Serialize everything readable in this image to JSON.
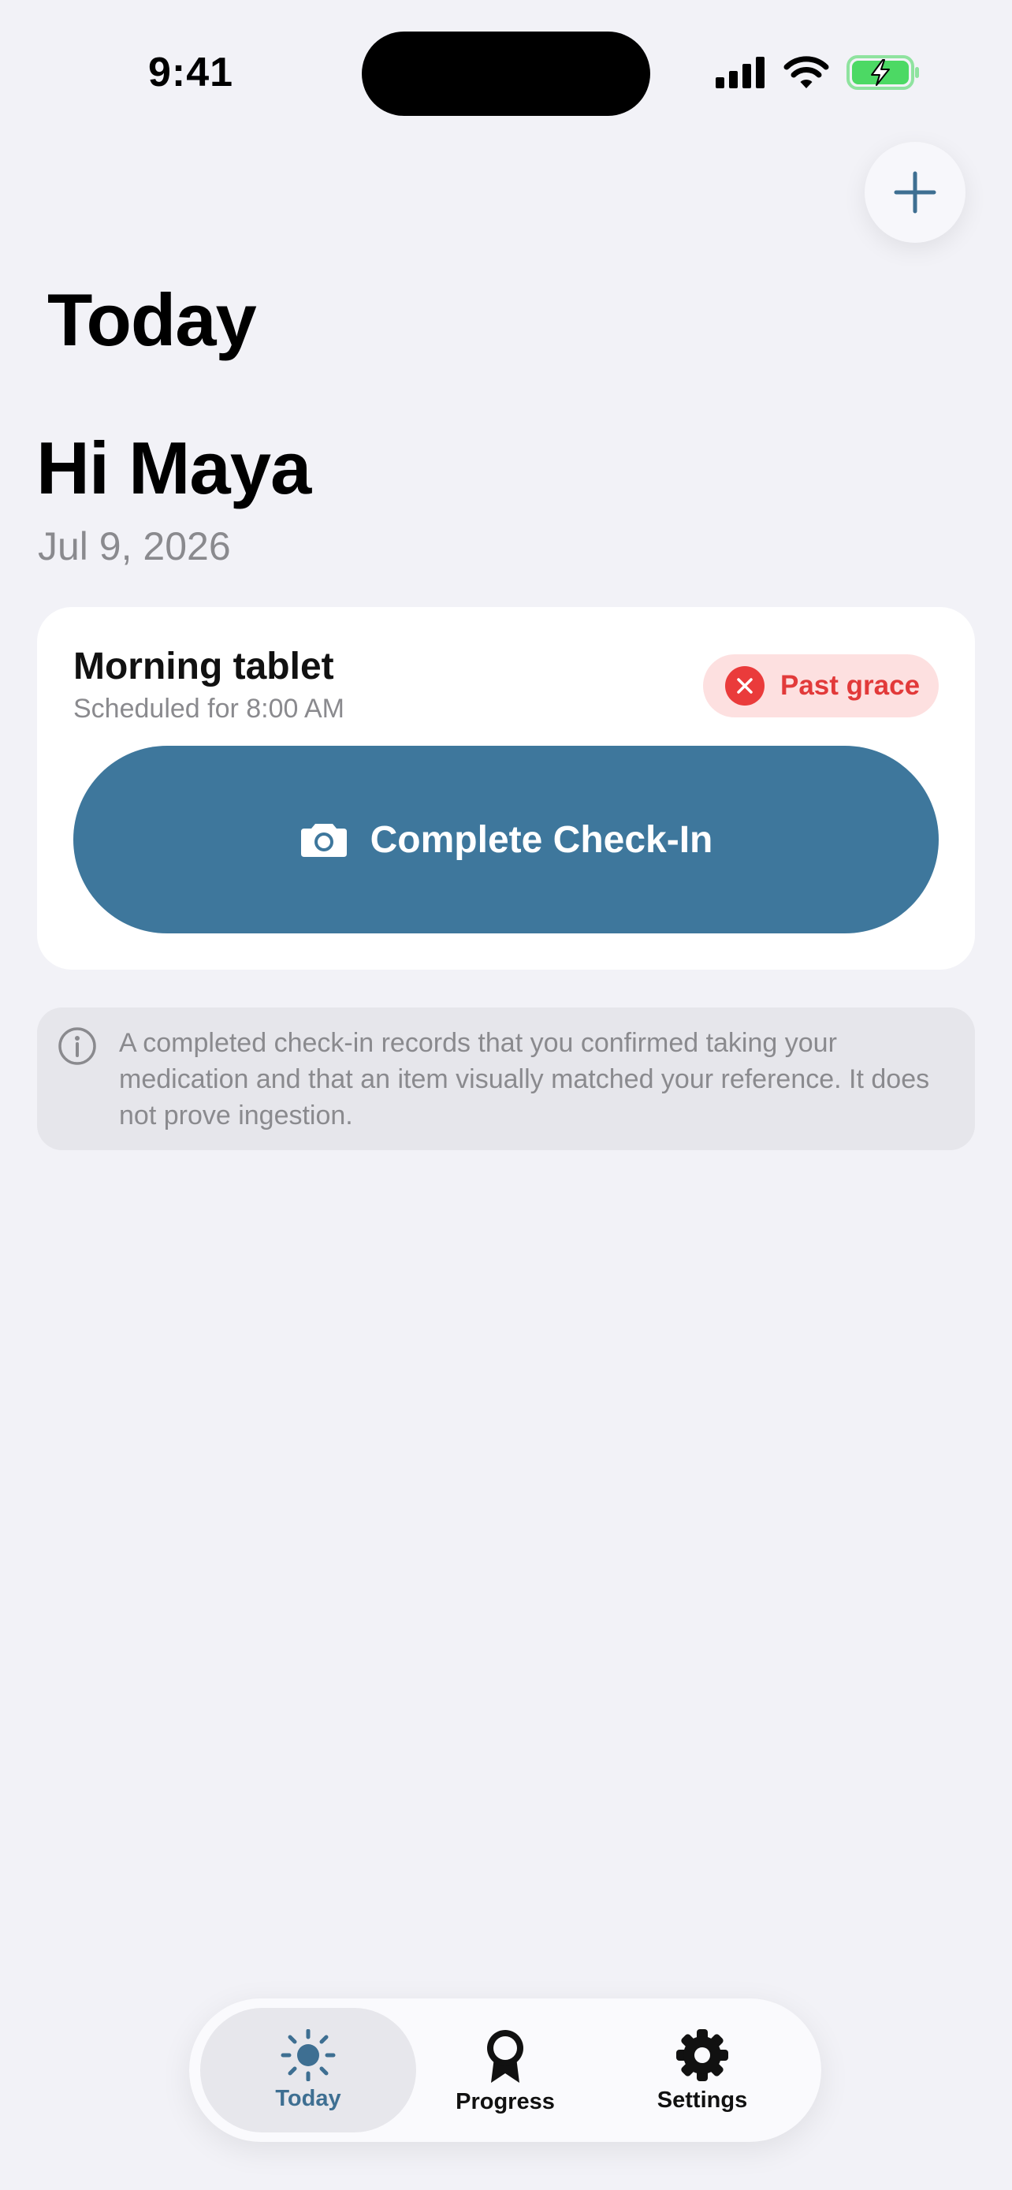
{
  "status_bar": {
    "time": "9:41"
  },
  "header": {
    "title": "Today"
  },
  "greeting": {
    "text": "Hi Maya",
    "date": "Jul 9, 2026"
  },
  "dose_card": {
    "name": "Morning tablet",
    "scheduled": "Scheduled for 8:00 AM",
    "status": "Past grace",
    "action_label": "Complete Check-In"
  },
  "info_note": {
    "text": "A completed check-in records that you confirmed taking your medication and that an item visually matched your reference. It does not prove ingestion."
  },
  "tab_bar": {
    "tabs": [
      {
        "label": "Today",
        "icon": "sun-icon",
        "active": true
      },
      {
        "label": "Progress",
        "icon": "award-ribbon-icon",
        "active": false
      },
      {
        "label": "Settings",
        "icon": "gear-icon",
        "active": false
      }
    ]
  },
  "colors": {
    "accent": "#3e779c",
    "background": "#f2f2f7",
    "status_red": "#e23a3a",
    "status_red_bg": "#fde0e0",
    "battery_green": "#4cd964"
  }
}
